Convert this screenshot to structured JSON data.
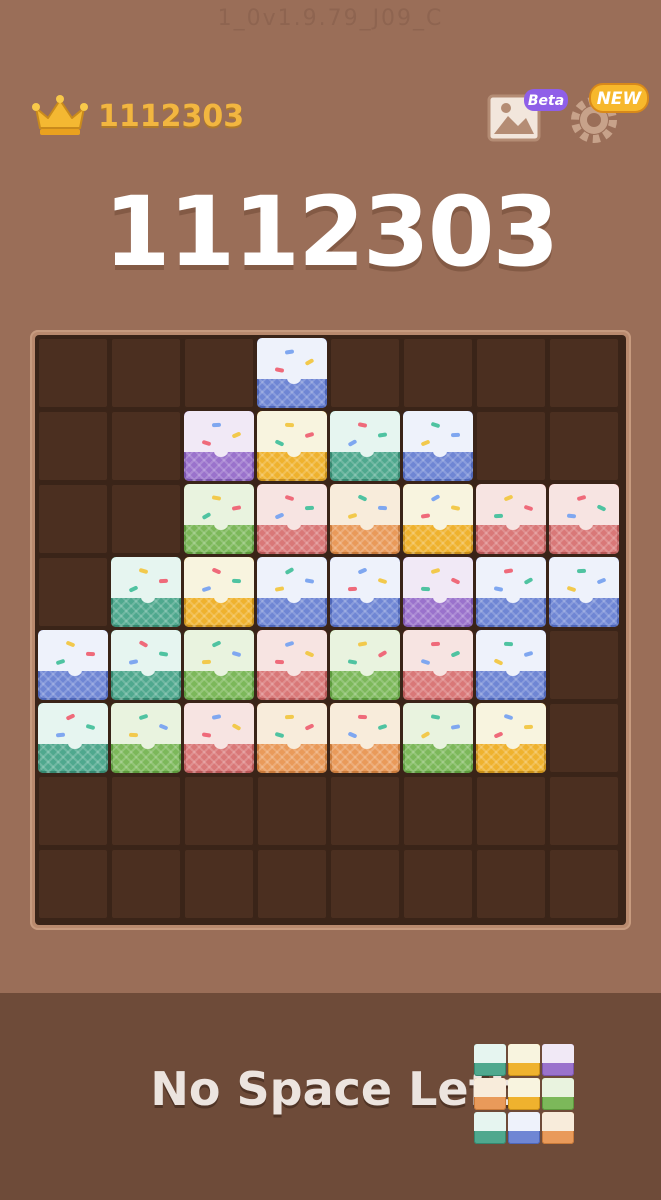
{
  "header": {
    "version": "1_0v1.9.79_J09_C",
    "best_score": "1112303",
    "gallery_badge": "Beta",
    "settings_badge": "NEW"
  },
  "score": "1112303",
  "board": {
    "rows": 8,
    "cols": 8,
    "grid": [
      [
        null,
        null,
        null,
        "blue",
        null,
        null,
        null,
        null
      ],
      [
        null,
        null,
        "purple",
        "yellow",
        "teal",
        "blue",
        null,
        null
      ],
      [
        null,
        null,
        "green",
        "red",
        "orange",
        "yellow",
        "red",
        "red"
      ],
      [
        null,
        "teal",
        "yellow",
        "blue",
        "blue",
        "purple",
        "blue",
        "blue"
      ],
      [
        "blue",
        "teal",
        "green",
        "red",
        "green",
        "red",
        "blue",
        null
      ],
      [
        "teal",
        "green",
        "red",
        "orange",
        "orange",
        "green",
        "yellow",
        null
      ],
      [
        null,
        null,
        null,
        null,
        null,
        null,
        null,
        null
      ],
      [
        null,
        null,
        null,
        null,
        null,
        null,
        null,
        null
      ]
    ]
  },
  "tray": {
    "message": "No Space Left",
    "piece": [
      [
        "teal",
        "yellow",
        "purple"
      ],
      [
        "orange",
        "yellow",
        "green"
      ],
      [
        "teal",
        "blue",
        "orange"
      ]
    ]
  },
  "colors": {
    "blue": {
      "wafer": "#6f86d4",
      "icing": "#eef2fb",
      "edge": "#4e66b8"
    },
    "purple": {
      "wafer": "#9a72cc",
      "icing": "#f1e9f6",
      "edge": "#7a54ad"
    },
    "yellow": {
      "wafer": "#efb22e",
      "icing": "#f8f4df",
      "edge": "#c98f18"
    },
    "teal": {
      "wafer": "#4fa88e",
      "icing": "#e6f5f0",
      "edge": "#35876f"
    },
    "green": {
      "wafer": "#7cb85a",
      "icing": "#e9f3df",
      "edge": "#5c9a3c"
    },
    "red": {
      "wafer": "#d97878",
      "icing": "#f7e4e2",
      "edge": "#b85757"
    },
    "orange": {
      "wafer": "#e99a5a",
      "icing": "#f8ecdb",
      "edge": "#c97a3a"
    }
  }
}
